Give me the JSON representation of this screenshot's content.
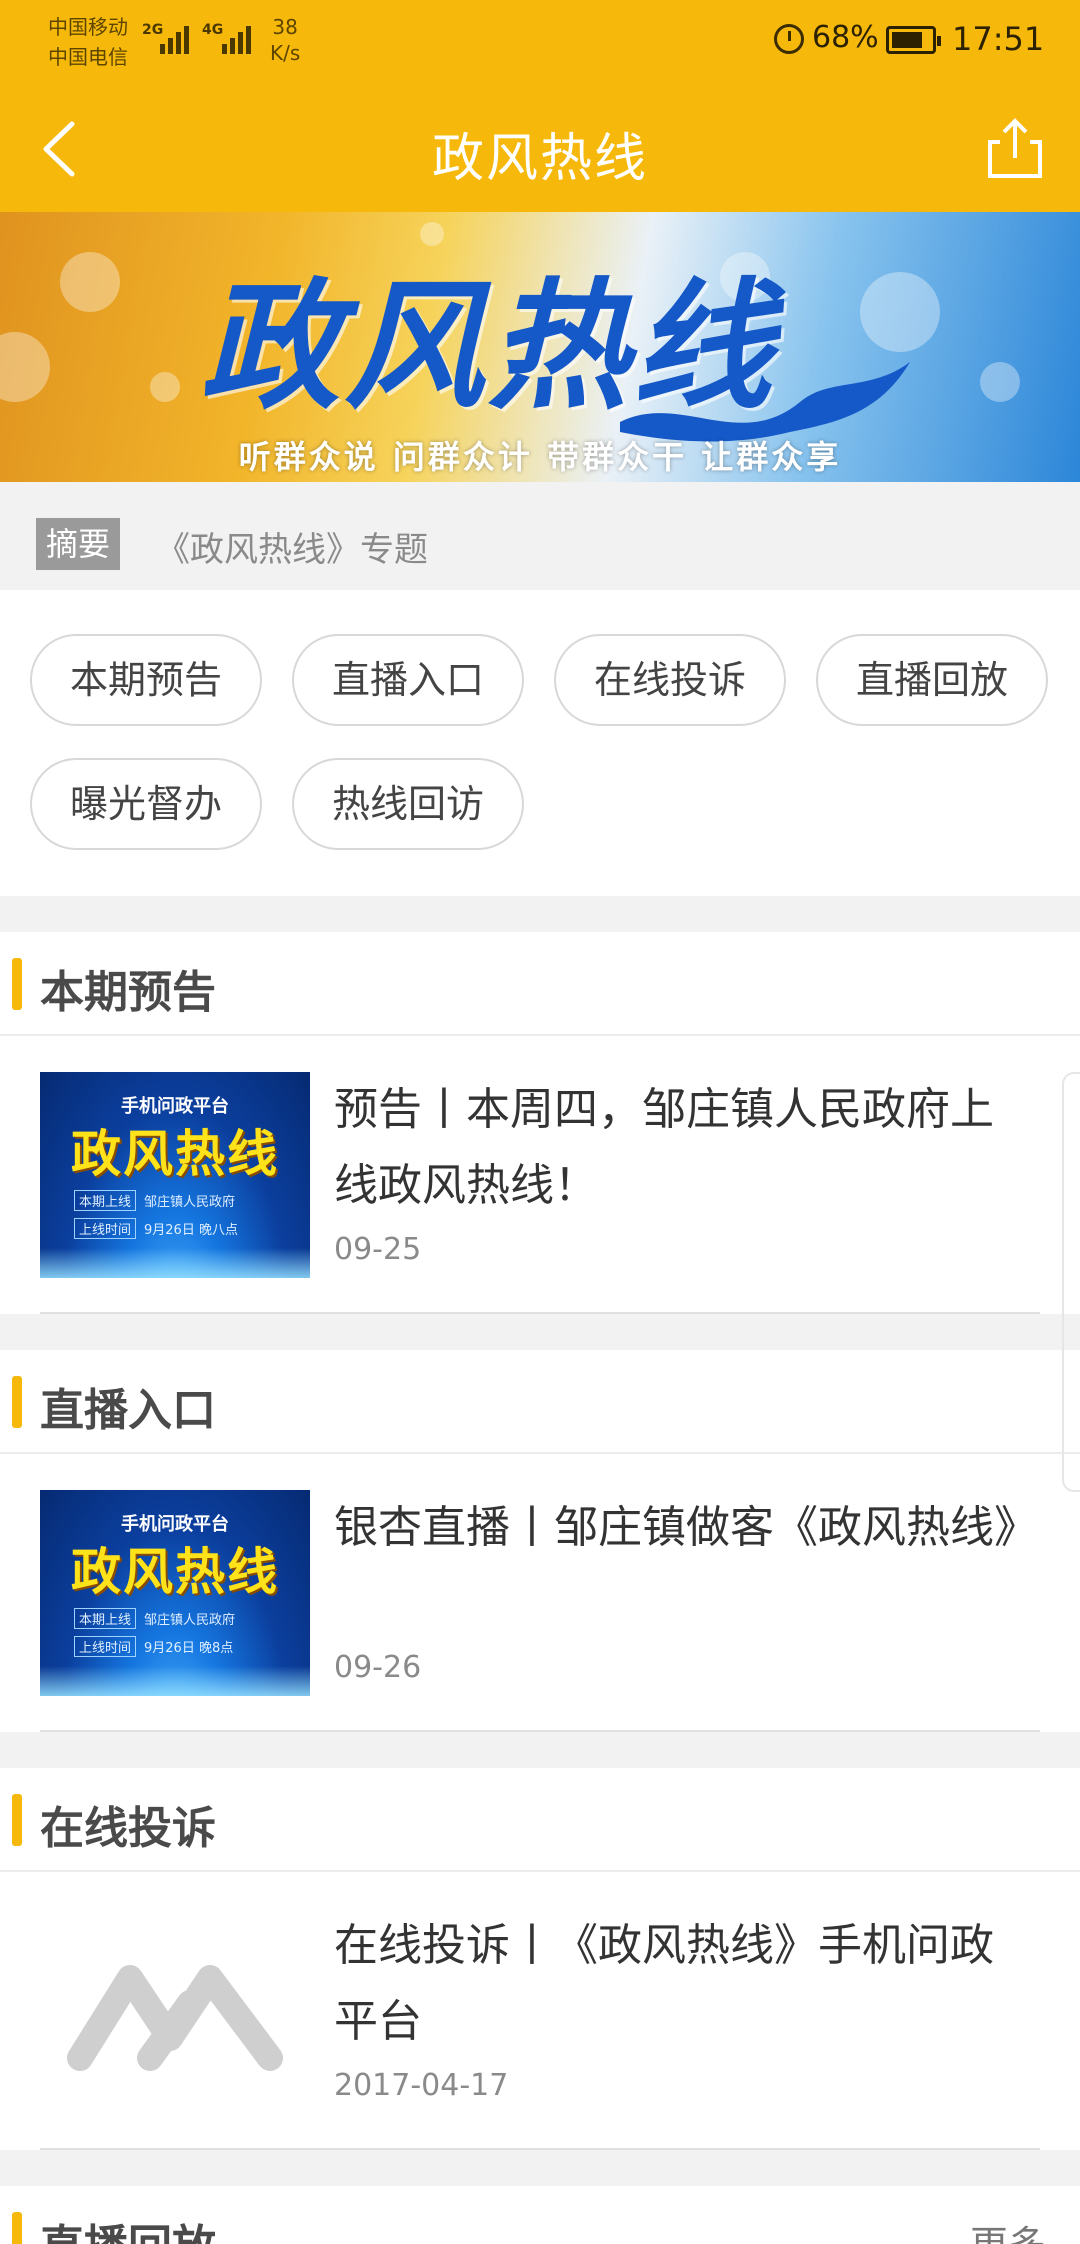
{
  "status_bar": {
    "carrier_1": "中国移动",
    "carrier_2": "中国电信",
    "net_1": "2G",
    "net_2": "4G",
    "speed_value": "38",
    "speed_unit": "K/s",
    "battery": "68%",
    "time": "17:51"
  },
  "header": {
    "title": "政风热线",
    "back_icon": "chevron-left-icon",
    "share_icon": "share-icon"
  },
  "banner": {
    "title": "政风热线",
    "slogan": "听群众说 问群众计 带群众干 让群众享"
  },
  "summary": {
    "tag": "摘要",
    "text": "《政风热线》专题"
  },
  "chips": [
    "本期预告",
    "直播入口",
    "在线投诉",
    "直播回放",
    "曝光督办",
    "热线回访"
  ],
  "sections": [
    {
      "title": "本期预告",
      "item": {
        "title": "预告丨本周四，邹庄镇人民政府上线政风热线！",
        "date": "09-25",
        "thumb": {
          "sub": "手机问政平台",
          "title": "政风热线",
          "line1_tag": "本期上线",
          "line1_text": "邹庄镇人民政府",
          "line2_tag": "上线时间",
          "line2_text": "9月26日 晚八点"
        }
      }
    },
    {
      "title": "直播入口",
      "item": {
        "title": "银杏直播丨邹庄镇做客《政风热线》",
        "date": "09-26",
        "thumb": {
          "sub": "手机问政平台",
          "title": "政风热线",
          "line1_tag": "本期上线",
          "line1_text": "邹庄镇人民政府",
          "line2_tag": "上线时间",
          "line2_text": "9月26日 晚8点"
        }
      }
    },
    {
      "title": "在线投诉",
      "item": {
        "title": "在线投诉丨《政风热线》手机问政平台",
        "date": "2017-04-17",
        "thumb_icon": "logo-placeholder-icon"
      }
    },
    {
      "title": "直播回放",
      "more": "更多"
    }
  ],
  "colors": {
    "accent": "#f6b90b",
    "banner_text": "#1558c7"
  }
}
